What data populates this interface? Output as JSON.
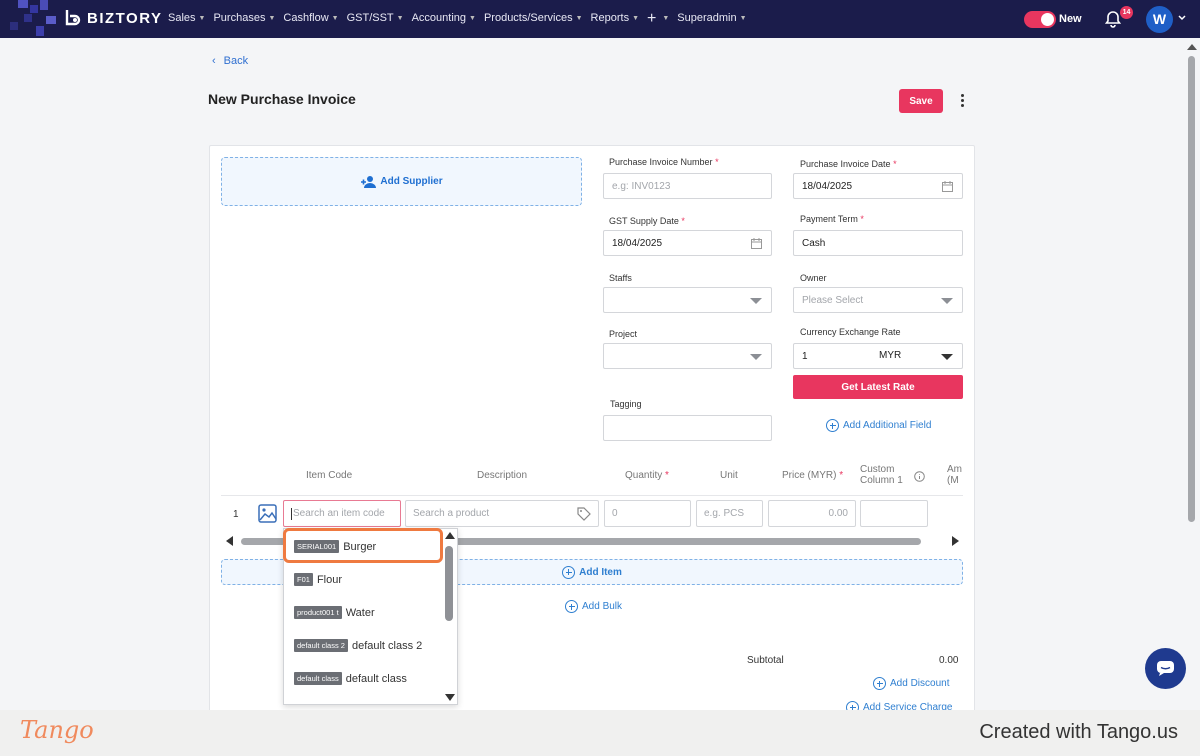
{
  "nav": {
    "brand": "BIZTORY",
    "menu": [
      "Sales",
      "Purchases",
      "Cashflow",
      "GST/SST",
      "Accounting",
      "Products/Services",
      "Reports"
    ],
    "superadmin": "Superadmin",
    "toggle_label": "New",
    "notification_count": "14",
    "avatar_initial": "W"
  },
  "page": {
    "back_label": "Back",
    "title": "New Purchase Invoice",
    "save_label": "Save"
  },
  "supplier": {
    "add_label": "Add Supplier"
  },
  "form": {
    "invoice_number": {
      "label": "Purchase Invoice Number",
      "placeholder": "e.g: INV0123"
    },
    "invoice_date": {
      "label": "Purchase Invoice Date",
      "value": "18/04/2025"
    },
    "gst_date": {
      "label": "GST Supply Date",
      "value": "18/04/2025"
    },
    "payment_term": {
      "label": "Payment Term",
      "value": "Cash"
    },
    "staffs": {
      "label": "Staffs"
    },
    "owner": {
      "label": "Owner",
      "placeholder": "Please Select"
    },
    "project": {
      "label": "Project"
    },
    "currency": {
      "label": "Currency Exchange Rate",
      "rate": "1",
      "code": "MYR"
    },
    "latest_rate_label": "Get Latest Rate",
    "tagging": {
      "label": "Tagging"
    },
    "add_field_label": "Add Additional Field"
  },
  "table": {
    "headers": {
      "item_code": "Item Code",
      "description": "Description",
      "quantity": "Quantity",
      "unit": "Unit",
      "price": "Price (MYR)",
      "custom1": "Custom",
      "custom2": "Column 1",
      "amount1": "Am",
      "amount2": "(M"
    },
    "row": {
      "number": "1",
      "code_placeholder": "Search an item code",
      "product_placeholder": "Search a product",
      "quantity_placeholder": "0",
      "unit_placeholder": "e.g. PCS",
      "price_placeholder": "0.00"
    },
    "add_item_label": "Add Item",
    "add_bulk_label": "Add Bulk"
  },
  "totals": {
    "subtotal_label": "Subtotal",
    "subtotal_value": "0.00",
    "add_discount_label": "Add Discount",
    "add_service_label": "Add Service Charge"
  },
  "dropdown": {
    "options": [
      {
        "code": "SERIAL001",
        "name": "Burger"
      },
      {
        "code": "F01",
        "name": "Flour"
      },
      {
        "code": "product001 t",
        "name": "Water"
      },
      {
        "code": "default class 2",
        "name": "default class 2"
      },
      {
        "code": "default class",
        "name": "default class"
      }
    ]
  },
  "footer": {
    "tango": "Tango",
    "created": "Created with Tango.us"
  },
  "colors": {
    "nav_bg": "#1b1c4b",
    "accent": "#e8365f",
    "link": "#2f7fd0",
    "highlight": "#ef7a40"
  }
}
